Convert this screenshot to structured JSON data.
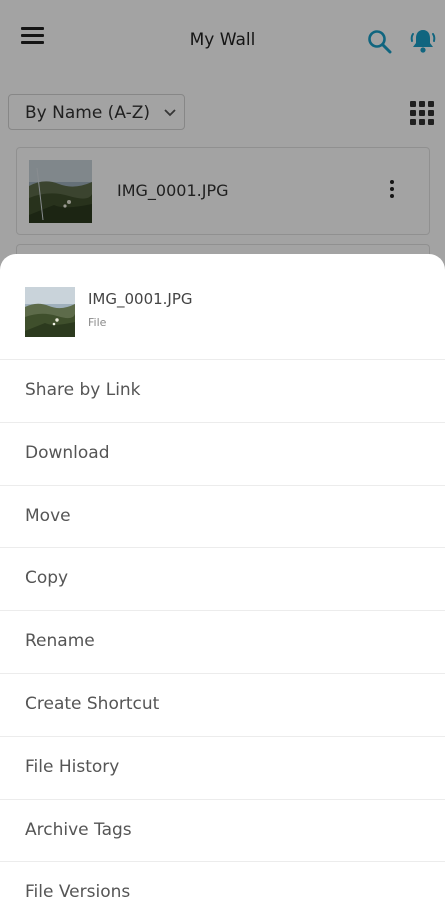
{
  "header": {
    "title": "My Wall",
    "menu_icon": "hamburger-menu-icon",
    "search_icon": "search-icon",
    "bell_icon": "bell-icon",
    "accent_color": "#1a9fc7"
  },
  "toolbar": {
    "sort_label": "By Name (A-Z)",
    "view_icon": "grid-view-icon"
  },
  "files": [
    {
      "name": "IMG_0001.JPG"
    }
  ],
  "sheet": {
    "file_name": "IMG_0001.JPG",
    "file_type": "File",
    "actions": [
      "Share by Link",
      "Download",
      "Move",
      "Copy",
      "Rename",
      "Create Shortcut",
      "File History",
      "Archive Tags",
      "File Versions"
    ]
  }
}
